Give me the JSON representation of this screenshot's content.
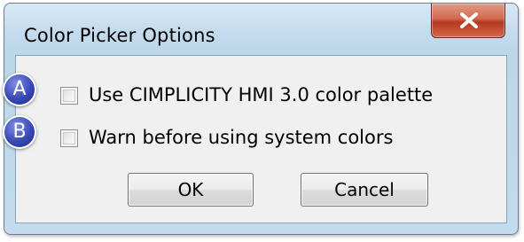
{
  "window": {
    "title": "Color Picker Options",
    "close_icon": "close-icon"
  },
  "options": [
    {
      "callout": "A",
      "label": "Use CIMPLICITY HMI 3.0 color palette",
      "checked": false
    },
    {
      "callout": "B",
      "label": "Warn before using system colors",
      "checked": false
    }
  ],
  "buttons": {
    "ok_label": "OK",
    "cancel_label": "Cancel"
  },
  "colors": {
    "callout": "#3a48b8",
    "close_button": "#c5502f"
  }
}
